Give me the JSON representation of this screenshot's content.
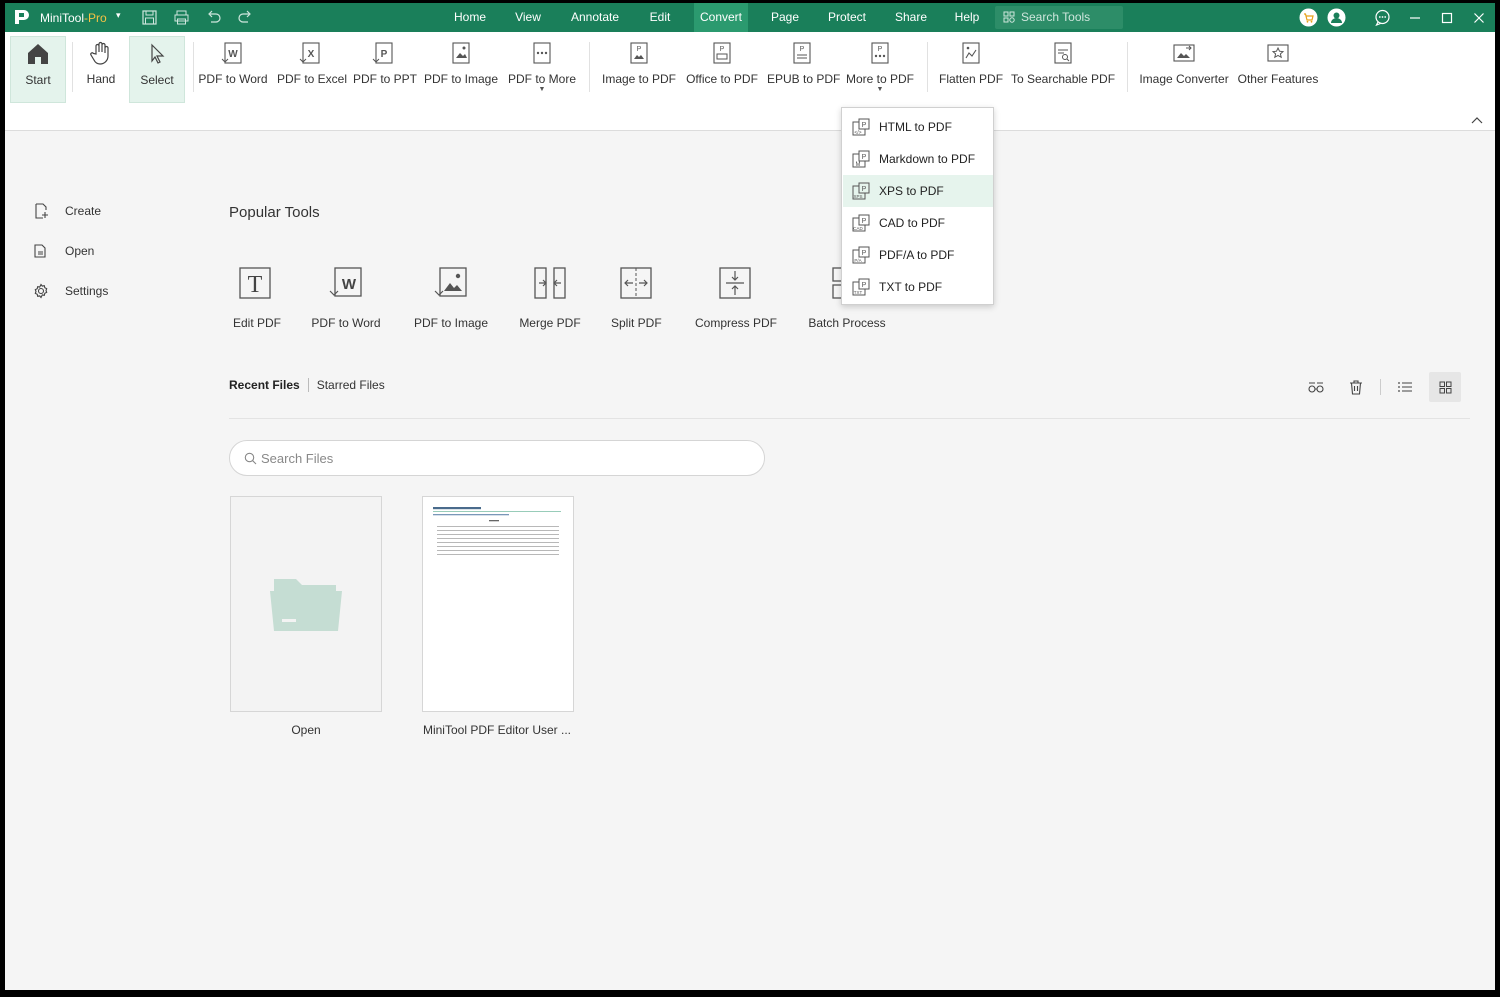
{
  "app": {
    "name": "MiniTool",
    "edition": "-Pro",
    "dropdown_glyph": "▾"
  },
  "title_menu": [
    {
      "label": "Home"
    },
    {
      "label": "View"
    },
    {
      "label": "Annotate"
    },
    {
      "label": "Edit"
    },
    {
      "label": "Convert",
      "active": true
    },
    {
      "label": "Page"
    },
    {
      "label": "Protect"
    },
    {
      "label": "Share"
    },
    {
      "label": "Help"
    }
  ],
  "search_tools": {
    "placeholder": "Search Tools"
  },
  "ribbon": {
    "start": "Start",
    "hand": "Hand",
    "select": "Select",
    "pdf_to_word": "PDF to Word",
    "pdf_to_excel": "PDF to Excel",
    "pdf_to_ppt": "PDF to PPT",
    "pdf_to_image": "PDF to Image",
    "pdf_to_more": "PDF to More",
    "image_to_pdf": "Image to PDF",
    "office_to_pdf": "Office to PDF",
    "epub_to_pdf": "EPUB to PDF",
    "more_to_pdf": "More to PDF",
    "flatten_pdf": "Flatten PDF",
    "to_searchable_pdf": "To Searchable PDF",
    "image_converter": "Image Converter",
    "other_features": "Other Features"
  },
  "sidebar": {
    "create": "Create",
    "open": "Open",
    "settings": "Settings"
  },
  "popular": {
    "title": "Popular Tools",
    "tools": {
      "edit_pdf": "Edit PDF",
      "pdf_to_word": "PDF to Word",
      "pdf_to_image": "PDF to Image",
      "merge_pdf": "Merge PDF",
      "split_pdf": "Split PDF",
      "compress_pdf": "Compress PDF",
      "batch_process": "Batch Process"
    }
  },
  "files": {
    "tab_recent": "Recent Files",
    "tab_starred": "Starred Files",
    "search_placeholder": "Search Files",
    "cards": {
      "open": "Open",
      "doc": "MiniTool PDF Editor User ..."
    }
  },
  "more_to_pdf_menu": {
    "html": "HTML to PDF",
    "markdown": "Markdown to PDF",
    "xps": "XPS to PDF",
    "cad": "CAD to PDF",
    "pdfa": "PDF/A to PDF",
    "txt": "TXT to PDF"
  },
  "colors": {
    "brand": "#1a7f5a",
    "menu_active": "#2b9a6f",
    "ribbon_active": "#e4f3ec",
    "folder": "#c5ddd3"
  }
}
